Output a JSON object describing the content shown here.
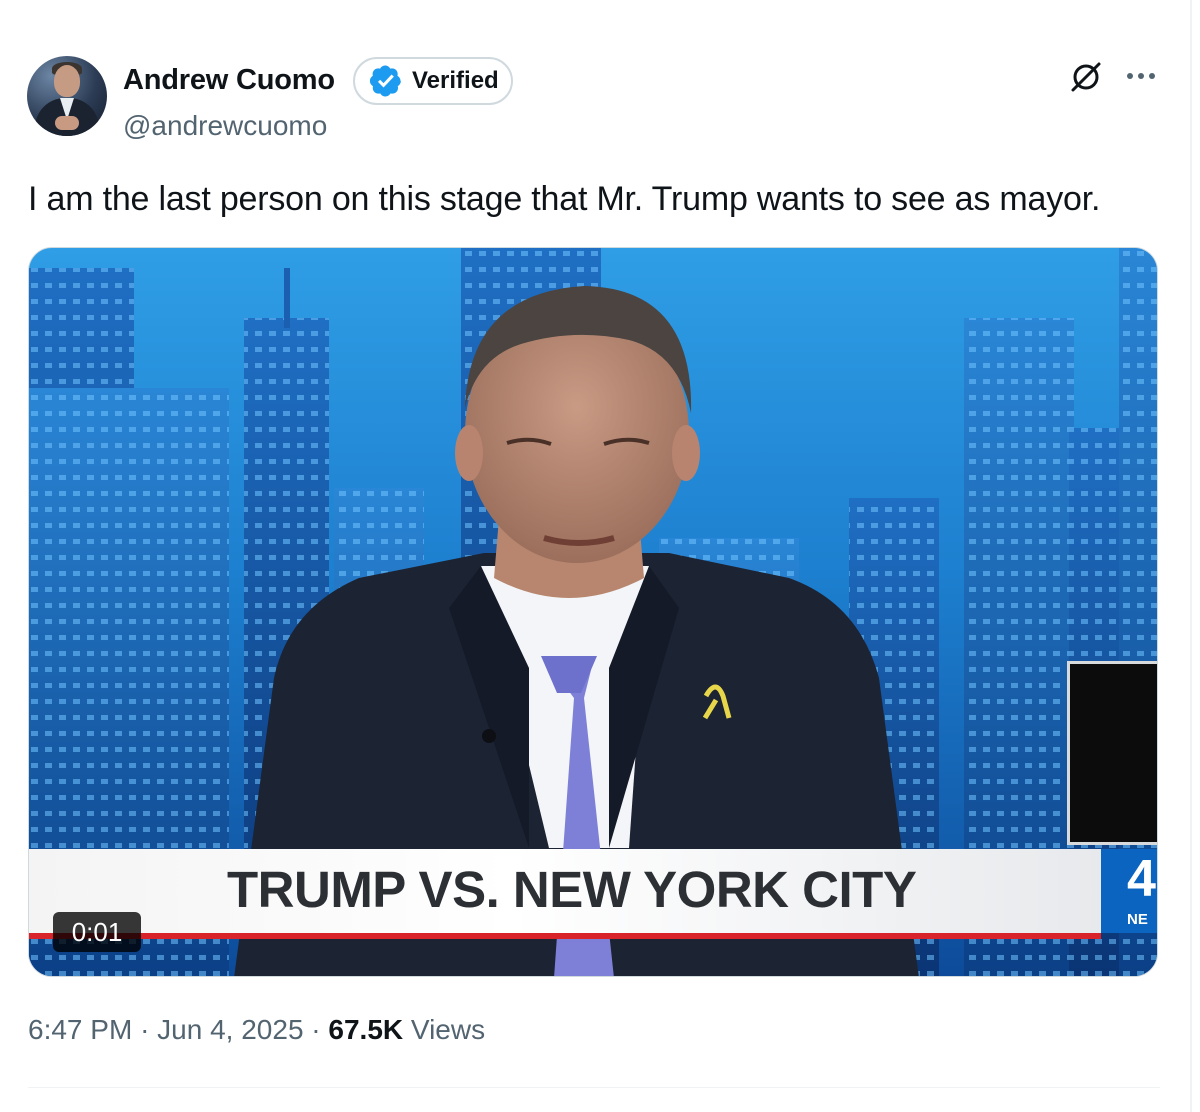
{
  "author": {
    "name": "Andrew Cuomo",
    "handle": "@andrewcuomo",
    "verified_label": "Verified",
    "avatar_icon": "profile-photo",
    "verified_icon": "verified-badge-icon"
  },
  "header_actions": {
    "grok_icon": "grok-icon",
    "more_icon": "more-options-icon"
  },
  "tweet": {
    "text": "I am the last person on this stage that Mr. Trump wants to see as mayor."
  },
  "media": {
    "type": "video",
    "duration": "0:01",
    "chyron": "TRUMP VS. NEW YORK CITY",
    "station_number": "4",
    "station_text": "NE"
  },
  "meta": {
    "time": "6:47 PM",
    "separator": "·",
    "date": "Jun 4, 2025",
    "views_count": "67.5K",
    "views_label": "Views"
  },
  "colors": {
    "verified_blue": "#1d9bf0",
    "secondary_text": "#536471",
    "primary_text": "#0f1419",
    "chyron_red": "#d8232a",
    "station_blue": "#0b64bf"
  }
}
